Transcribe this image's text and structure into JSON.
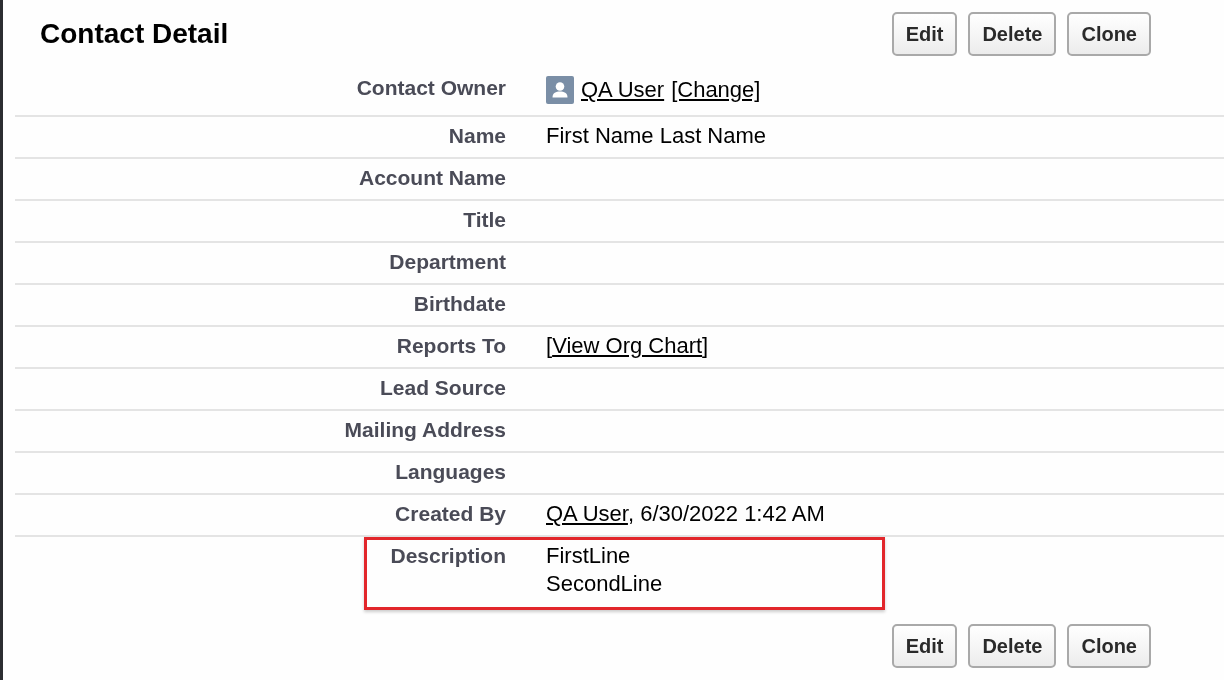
{
  "header": {
    "title": "Contact Detail",
    "buttons": [
      "Edit",
      "Delete",
      "Clone"
    ]
  },
  "fields": [
    {
      "label": "Contact Owner",
      "kind": "owner",
      "link": "QA User",
      "action": "[Change]",
      "highlighted": false
    },
    {
      "label": "Name",
      "kind": "text",
      "value": "First Name Last Name",
      "highlighted": false
    },
    {
      "label": "Account Name",
      "kind": "text",
      "highlighted": false
    },
    {
      "label": "Title",
      "kind": "text",
      "highlighted": false
    },
    {
      "label": "Department",
      "kind": "text",
      "highlighted": false
    },
    {
      "label": "Birthdate",
      "kind": "text",
      "highlighted": false
    },
    {
      "label": "Reports To",
      "kind": "linked",
      "before": "[",
      "link": "View Org Chart",
      "after": "]",
      "highlighted": false
    },
    {
      "label": "Lead Source",
      "kind": "text",
      "highlighted": false
    },
    {
      "label": "Mailing Address",
      "kind": "text",
      "highlighted": false
    },
    {
      "label": "Languages",
      "kind": "text",
      "highlighted": false
    },
    {
      "label": "Created By",
      "kind": "linked",
      "link": "QA User",
      "after": ", 6/30/2022 1:42 AM",
      "highlighted": false
    },
    {
      "label": "Description",
      "kind": "text",
      "value": "FirstLine\nSecondLine",
      "highlighted": true
    }
  ],
  "footer": {
    "buttons": [
      "Edit",
      "Delete",
      "Clone"
    ]
  }
}
